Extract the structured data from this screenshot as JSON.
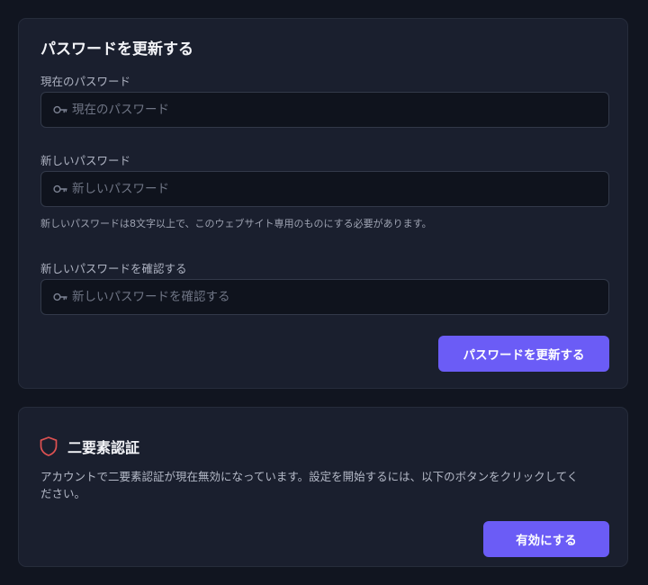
{
  "password_card": {
    "title": "パスワードを更新する",
    "current": {
      "label": "現在のパスワード",
      "placeholder": "現在のパスワード",
      "value": ""
    },
    "new": {
      "label": "新しいパスワード",
      "placeholder": "新しいパスワード",
      "value": "",
      "helper": "新しいパスワードは8文字以上で、このウェブサイト専用のものにする必要があります。"
    },
    "confirm": {
      "label": "新しいパスワードを確認する",
      "placeholder": "新しいパスワードを確認する",
      "value": ""
    },
    "submit_label": "パスワードを更新する"
  },
  "twofa_card": {
    "title": "二要素認証",
    "description": "アカウントで二要素認証が現在無効になっています。設定を開始するには、以下のボタンをクリックしてください。",
    "enable_label": "有効にする"
  },
  "icons": {
    "field_icon": "key-icon",
    "twofa_icon": "shield-icon"
  },
  "colors": {
    "page_background": "#111520",
    "card_background": "#1a1f2e",
    "input_background": "#0f131d",
    "accent": "#6b5cf6",
    "shield": "#e05252"
  }
}
